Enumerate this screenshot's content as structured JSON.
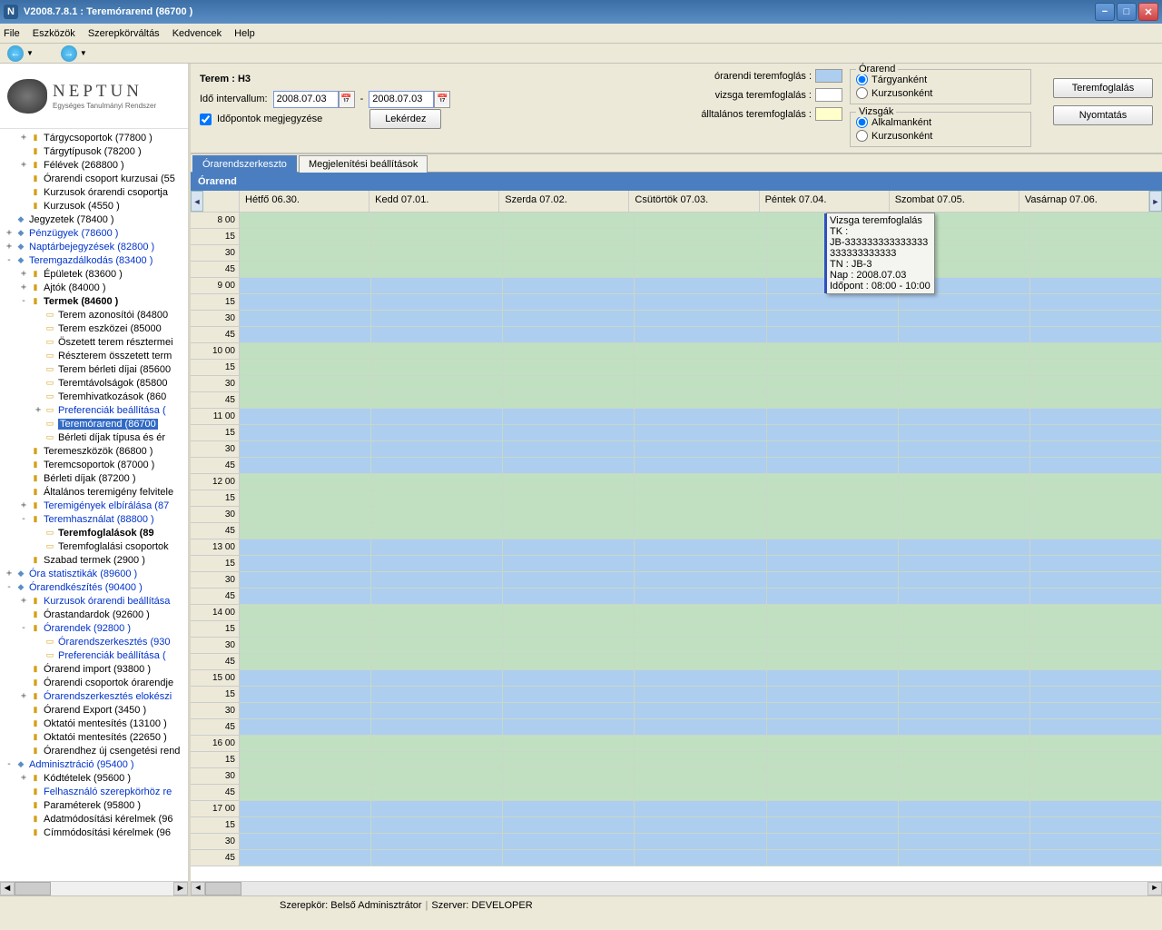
{
  "window": {
    "title": "V2008.7.8.1 : Teremórarend (86700  )"
  },
  "menu": [
    "File",
    "Eszközök",
    "Szerepkörváltás",
    "Kedvencek",
    "Help"
  ],
  "logo": {
    "name": "NEPTUN",
    "subtitle": "Egységes Tanulmányi Rendszer"
  },
  "tree": [
    {
      "ind": 1,
      "tw": "+",
      "ic": "folder",
      "lbl": "Tárgycsoportok (77800  )"
    },
    {
      "ind": 1,
      "tw": "",
      "ic": "folder",
      "lbl": "Tárgytípusok (78200  )"
    },
    {
      "ind": 1,
      "tw": "+",
      "ic": "folder",
      "lbl": "Félévek (268800  )"
    },
    {
      "ind": 1,
      "tw": "",
      "ic": "folder",
      "lbl": "Órarendi csoport kurzusai (55"
    },
    {
      "ind": 1,
      "tw": "",
      "ic": "folder",
      "lbl": "Kurzusok órarendi csoportja"
    },
    {
      "ind": 1,
      "tw": "",
      "ic": "folder",
      "lbl": "Kurzusok (4550  )"
    },
    {
      "ind": 0,
      "tw": "",
      "ic": "diamond",
      "lbl": "Jegyzetek (78400  )"
    },
    {
      "ind": 0,
      "tw": "+",
      "ic": "diamond",
      "lbl": "Pénzügyek (78600  )",
      "blue": true
    },
    {
      "ind": 0,
      "tw": "+",
      "ic": "diamond",
      "lbl": "Naptárbejegyzések (82800  )",
      "blue": true
    },
    {
      "ind": 0,
      "tw": "-",
      "ic": "diamond",
      "lbl": "Teremgazdálkodás (83400  )",
      "blue": true
    },
    {
      "ind": 1,
      "tw": "+",
      "ic": "folder",
      "lbl": "Épületek (83600  )"
    },
    {
      "ind": 1,
      "tw": "+",
      "ic": "folder",
      "lbl": "Ajtók (84000  )"
    },
    {
      "ind": 1,
      "tw": "-",
      "ic": "folder",
      "lbl": "Termek (84600  )",
      "bold": true
    },
    {
      "ind": 2,
      "tw": "",
      "ic": "page",
      "lbl": "Terem azonosítói (84800"
    },
    {
      "ind": 2,
      "tw": "",
      "ic": "page",
      "lbl": "Terem eszközei (85000"
    },
    {
      "ind": 2,
      "tw": "",
      "ic": "page",
      "lbl": "Öszetett terem résztermei"
    },
    {
      "ind": 2,
      "tw": "",
      "ic": "page",
      "lbl": "Részterem összetett term"
    },
    {
      "ind": 2,
      "tw": "",
      "ic": "page",
      "lbl": "Terem bérleti díjai (85600"
    },
    {
      "ind": 2,
      "tw": "",
      "ic": "page",
      "lbl": "Teremtávolságok (85800"
    },
    {
      "ind": 2,
      "tw": "",
      "ic": "page",
      "lbl": "Teremhivatkozások (860"
    },
    {
      "ind": 2,
      "tw": "+",
      "ic": "page",
      "lbl": "Preferenciák beállítása (",
      "blue": true
    },
    {
      "ind": 2,
      "tw": "",
      "ic": "page",
      "lbl": "Teremórarend (86700",
      "sel": true
    },
    {
      "ind": 2,
      "tw": "",
      "ic": "page",
      "lbl": "Bérleti díjak típusa és ér"
    },
    {
      "ind": 1,
      "tw": "",
      "ic": "folder",
      "lbl": "Teremeszközök (86800  )"
    },
    {
      "ind": 1,
      "tw": "",
      "ic": "folder",
      "lbl": "Teremcsoportok (87000  )"
    },
    {
      "ind": 1,
      "tw": "",
      "ic": "folder",
      "lbl": "Bérleti díjak (87200  )"
    },
    {
      "ind": 1,
      "tw": "",
      "ic": "folder",
      "lbl": "Általános teremigény felvitele"
    },
    {
      "ind": 1,
      "tw": "+",
      "ic": "folder",
      "lbl": "Teremigények elbírálása (87",
      "blue": true
    },
    {
      "ind": 1,
      "tw": "-",
      "ic": "folder",
      "lbl": "Teremhasználat (88800  )",
      "blue": true
    },
    {
      "ind": 2,
      "tw": "",
      "ic": "page",
      "lbl": "Teremfoglalások (89",
      "bold": true
    },
    {
      "ind": 2,
      "tw": "",
      "ic": "page",
      "lbl": "Teremfoglalási csoportok"
    },
    {
      "ind": 1,
      "tw": "",
      "ic": "folder",
      "lbl": "Szabad termek (2900  )"
    },
    {
      "ind": 0,
      "tw": "+",
      "ic": "diamond",
      "lbl": "Óra statisztikák (89600  )",
      "blue": true
    },
    {
      "ind": 0,
      "tw": "-",
      "ic": "diamond",
      "lbl": "Órarendkészítés (90400  )",
      "blue": true
    },
    {
      "ind": 1,
      "tw": "+",
      "ic": "folder",
      "lbl": "Kurzusok órarendi beállítása",
      "blue": true
    },
    {
      "ind": 1,
      "tw": "",
      "ic": "folder",
      "lbl": "Órastandardok (92600  )"
    },
    {
      "ind": 1,
      "tw": "-",
      "ic": "folder",
      "lbl": "Órarendek (92800  )",
      "blue": true
    },
    {
      "ind": 2,
      "tw": "",
      "ic": "page",
      "lbl": "Órarendszerkesztés (930",
      "blue": true
    },
    {
      "ind": 2,
      "tw": "",
      "ic": "page",
      "lbl": "Preferenciák beállítása (",
      "blue": true
    },
    {
      "ind": 1,
      "tw": "",
      "ic": "folder",
      "lbl": "Órarend import (93800  )"
    },
    {
      "ind": 1,
      "tw": "",
      "ic": "folder",
      "lbl": "Órarendi csoportok órarendje"
    },
    {
      "ind": 1,
      "tw": "+",
      "ic": "folder",
      "lbl": "Órarendszerkesztés elokészi",
      "blue": true
    },
    {
      "ind": 1,
      "tw": "",
      "ic": "folder",
      "lbl": "Órarend Export (3450  )"
    },
    {
      "ind": 1,
      "tw": "",
      "ic": "folder",
      "lbl": "Oktatói mentesítés (13100  )"
    },
    {
      "ind": 1,
      "tw": "",
      "ic": "folder",
      "lbl": "Oktatói mentesítés (22650  )"
    },
    {
      "ind": 1,
      "tw": "",
      "ic": "folder",
      "lbl": "Órarendhez új csengetési rend"
    },
    {
      "ind": 0,
      "tw": "-",
      "ic": "diamond",
      "lbl": "Adminisztráció (95400  )",
      "blue": true
    },
    {
      "ind": 1,
      "tw": "+",
      "ic": "folder",
      "lbl": "Kódtételek (95600  )"
    },
    {
      "ind": 1,
      "tw": "",
      "ic": "folder",
      "lbl": "Felhasználó szerepkörhöz re",
      "blue": true
    },
    {
      "ind": 1,
      "tw": "",
      "ic": "folder",
      "lbl": "Paraméterek (95800  )"
    },
    {
      "ind": 1,
      "tw": "",
      "ic": "folder",
      "lbl": "Adatmódosítási kérelmek (96"
    },
    {
      "ind": 1,
      "tw": "",
      "ic": "folder",
      "lbl": "Címmódosítási kérelmek (96"
    }
  ],
  "form": {
    "terem_label": "Terem :",
    "terem_value": "H3",
    "interval_label": "Idő intervallum:",
    "date_from": "2008.07.03",
    "date_to": "2008.07.03",
    "remember_label": "Időpontok megjegyzése",
    "query_btn": "Lekérdez",
    "leg1": "órarendi teremfoglás :",
    "leg2": "vizsga teremfoglalás :",
    "leg3": "álltalános teremfoglalás :",
    "grp1_title": "Órarend",
    "grp1_opt1": "Tárgyanként",
    "grp1_opt2": "Kurzusonként",
    "grp2_title": "Vizsgák",
    "grp2_opt1": "Alkalmanként",
    "grp2_opt2": "Kurzusonként",
    "btn1": "Teremfoglalás",
    "btn2": "Nyomtatás"
  },
  "tabs": {
    "t1": "Órarendszerkeszto",
    "t2": "Megjelenítési beállítások"
  },
  "sched": {
    "title": "Órarend",
    "days": [
      "Hétfő  06.30.",
      "Kedd  07.01.",
      "Szerda  07.02.",
      "Csütörtök  07.03.",
      "Péntek  07.04.",
      "Szombat  07.05.",
      "Vasárnap  07.06."
    ],
    "hours": [
      8,
      9,
      10,
      11,
      12,
      13,
      14,
      15,
      16,
      17
    ],
    "minutes": [
      "00",
      "15",
      "30",
      "45"
    ],
    "pattern_comment": "Each hour block alternates green/blue; hours 8-9 green, 10-11 blue-ish pattern per screenshot",
    "colors": [
      "green",
      "green",
      "green",
      "green",
      "blue",
      "blue",
      "blue",
      "blue"
    ]
  },
  "tooltip": {
    "l1": "Vizsga teremfoglalás",
    "l2": "TK :",
    "l3": "JB-333333333333333333333333333",
    "l4": "TN : JB-3",
    "l5": "Nap : 2008.07.03",
    "l6": "Időpont : 08:00 - 10:00"
  },
  "status": {
    "role_lbl": "Szerepkör:",
    "role": "Belső Adminisztrátor",
    "srv_lbl": "Szerver:",
    "srv": "DEVELOPER"
  }
}
